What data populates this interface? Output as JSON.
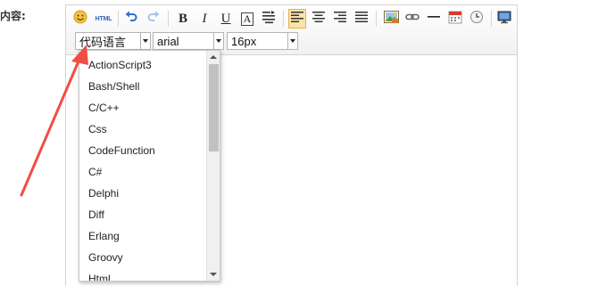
{
  "form": {
    "label": "内容:"
  },
  "toolbar": {
    "html_label": "HTML",
    "bold_label": "B",
    "italic_label": "I",
    "underline_label": "U",
    "fontcolor_label": "A",
    "accent": "#fbe2a9"
  },
  "selects": {
    "code_language": "代码语言",
    "font_family": "arial",
    "font_size": "16px"
  },
  "dropdown": {
    "items": [
      "ActionScript3",
      "Bash/Shell",
      "C/C++",
      "Css",
      "CodeFunction",
      "C#",
      "Delphi",
      "Diff",
      "Erlang",
      "Groovy",
      "Html"
    ]
  },
  "annotation": {
    "color": "#f04e45"
  }
}
